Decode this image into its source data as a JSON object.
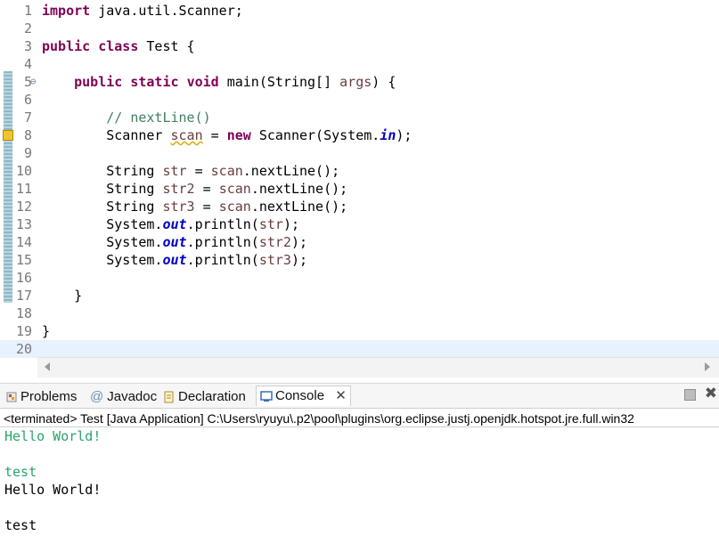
{
  "editor": {
    "lines": [
      {
        "n": "1",
        "t": "import java.util.Scanner;"
      },
      {
        "n": "2",
        "t": ""
      },
      {
        "n": "3",
        "t": "public class Test {"
      },
      {
        "n": "4",
        "t": ""
      },
      {
        "n": "5",
        "t": "    public static void main(String[] args) {"
      },
      {
        "n": "6",
        "t": ""
      },
      {
        "n": "7",
        "t": "        // nextLine()"
      },
      {
        "n": "8",
        "t": "        Scanner scan = new Scanner(System.in);"
      },
      {
        "n": "9",
        "t": ""
      },
      {
        "n": "10",
        "t": "        String str = scan.nextLine();"
      },
      {
        "n": "11",
        "t": "        String str2 = scan.nextLine();"
      },
      {
        "n": "12",
        "t": "        String str3 = scan.nextLine();"
      },
      {
        "n": "13",
        "t": "        System.out.println(str);"
      },
      {
        "n": "14",
        "t": "        System.out.println(str2);"
      },
      {
        "n": "15",
        "t": "        System.out.println(str3);"
      },
      {
        "n": "16",
        "t": ""
      },
      {
        "n": "17",
        "t": "    }"
      },
      {
        "n": "18",
        "t": ""
      },
      {
        "n": "19",
        "t": "}"
      },
      {
        "n": "20",
        "t": ""
      }
    ]
  },
  "views": {
    "problems": "Problems",
    "javadoc": "Javadoc",
    "declaration": "Declaration",
    "console": "Console"
  },
  "status_text": "<terminated> Test [Java Application] C:\\Users\\ryuyu\\.p2\\pool\\plugins\\org.eclipse.justj.openjdk.hotspot.jre.full.win32",
  "console_output": [
    "Hello World!",
    "",
    "test",
    "Hello World!",
    "",
    "test"
  ],
  "colors": {
    "console_input": "#29a56c",
    "keyword": "#7f0055",
    "comment": "#3f7f5f",
    "field": "#0000c0"
  }
}
